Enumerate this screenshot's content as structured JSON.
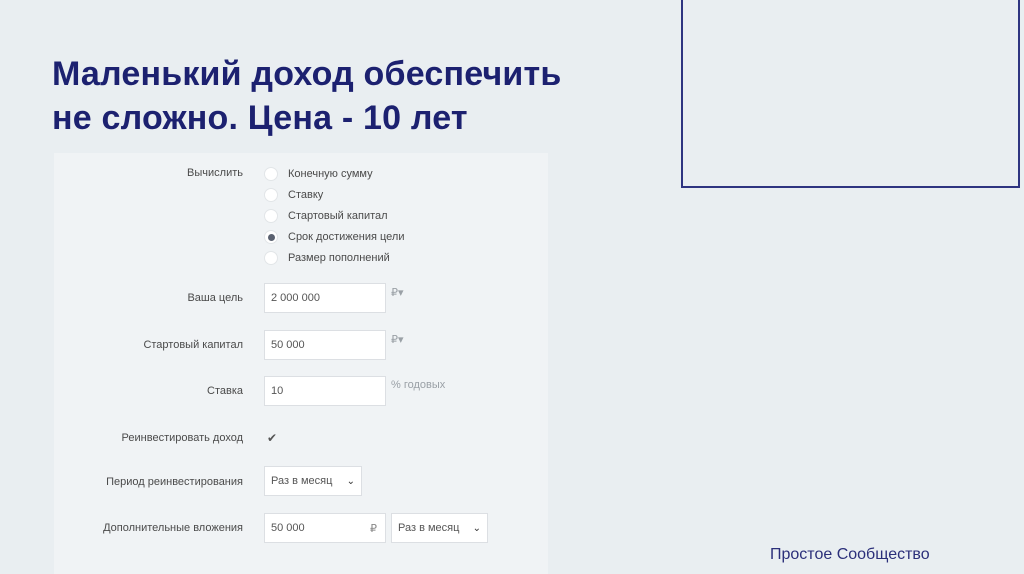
{
  "slide": {
    "title_line1": "Маленький доход обеспечить",
    "title_line2": "не сложно. Цена - 10 лет",
    "footer": "Простое Сообщество"
  },
  "calculator": {
    "compute_label": "Вычислить",
    "options": [
      {
        "label": "Конечную сумму",
        "selected": false
      },
      {
        "label": "Ставку",
        "selected": false
      },
      {
        "label": "Стартовый капитал",
        "selected": false
      },
      {
        "label": "Срок достижения цели",
        "selected": true
      },
      {
        "label": "Размер пополнений",
        "selected": false
      }
    ],
    "goal": {
      "label": "Ваша цель",
      "value": "2 000 000",
      "currency": "₽▾"
    },
    "start_capital": {
      "label": "Стартовый капитал",
      "value": "50 000",
      "currency": "₽▾"
    },
    "rate": {
      "label": "Ставка",
      "value": "10",
      "unit": "% годовых"
    },
    "reinvest": {
      "label": "Реинвестировать доход",
      "checked": true,
      "mark": "✔"
    },
    "reinvest_period": {
      "label": "Период реинвестирования",
      "value": "Раз в месяц"
    },
    "additional": {
      "label": "Дополнительные вложения",
      "value": "50 000",
      "currency": "₽",
      "period": "Раз в месяц"
    },
    "chevron": "⌄"
  },
  "colors": {
    "title": "#1c2170",
    "background": "#e9eef1",
    "frame_border": "#2e3480"
  }
}
